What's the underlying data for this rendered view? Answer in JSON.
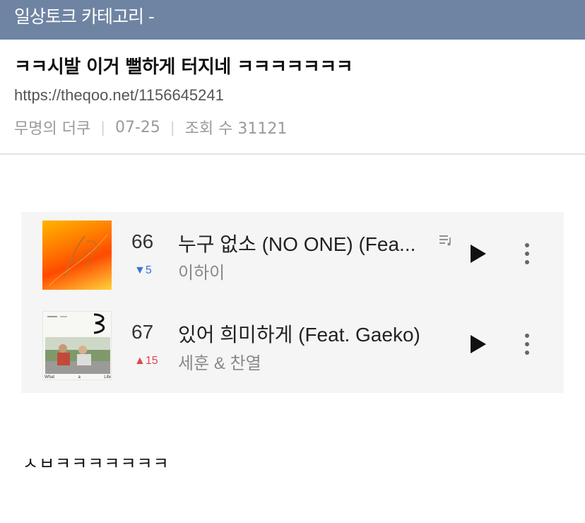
{
  "header": {
    "category": "일상토크 카테고리 -"
  },
  "post": {
    "title": "ㅋㅋ시발 이거 뻘하게 터지네 ㅋㅋㅋㅋㅋㅋㅋ",
    "url": "https://theqoo.net/1156645241",
    "author": "무명의 더쿠",
    "date": "07-25",
    "views": "조회 수 31121"
  },
  "chart": {
    "rows": [
      {
        "rank": "66",
        "change": "▼5",
        "change_dir": "down",
        "title": "누구 없소 (NO ONE) (Fea...",
        "artist": "이하이",
        "album_art_icon": "album-art-orange-lettering"
      },
      {
        "rank": "67",
        "change": "▲15",
        "change_dir": "up",
        "title": "있어 희미하게 (Feat. Gaeko)",
        "artist": "세훈 & 찬열",
        "album_art_icon": "album-art-what-a-life",
        "album_art_text": [
          "What",
          "a",
          "Life"
        ]
      }
    ],
    "icons": {
      "lyrics": "lyrics-icon",
      "play": "play-icon",
      "more": "more-icon"
    }
  },
  "comment": "ㅅㅂㅋㅋㅋㅋㅋㅋㅋ",
  "colors": {
    "topbar": "#6f84a3",
    "down": "#3b74d8",
    "up": "#e0454f"
  }
}
